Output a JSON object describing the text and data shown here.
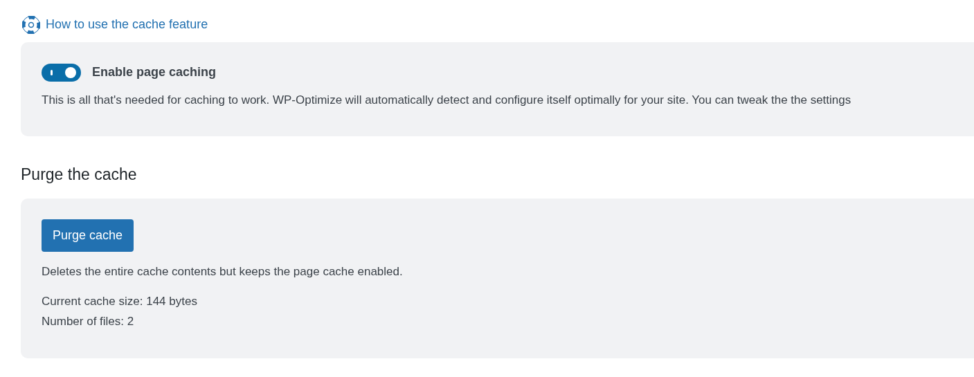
{
  "help_link": {
    "label": "How to use the cache feature"
  },
  "caching": {
    "label": "Enable page caching",
    "on": true,
    "description": "This is all that's needed for caching to work. WP-Optimize will automatically detect and configure itself optimally for your site. You can tweak the the settings"
  },
  "purge": {
    "heading": "Purge the cache",
    "button": "Purge cache",
    "description": "Deletes the entire cache contents but keeps the page cache enabled.",
    "stats": [
      "Current cache size: 144 bytes",
      "Number of files: 2"
    ]
  }
}
